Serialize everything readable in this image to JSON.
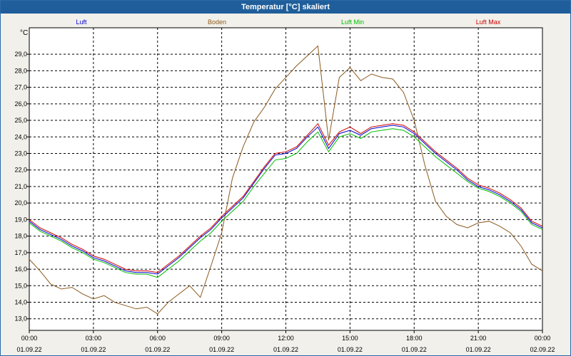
{
  "window": {
    "title": "Temperatur [°C] skaliert"
  },
  "chart_data": {
    "type": "line",
    "title": "Temperatur [°C] skaliert",
    "ylabel": "°C",
    "ylim": [
      12.3,
      30.6
    ],
    "grid": true,
    "legend_placement": "top",
    "y_ticks": [
      "13,0",
      "14,0",
      "15,0",
      "16,0",
      "17,0",
      "18,0",
      "19,0",
      "20,0",
      "21,0",
      "22,0",
      "23,0",
      "24,0",
      "25,0",
      "26,0",
      "27,0",
      "28,0",
      "29,0"
    ],
    "x_ticks": [
      {
        "time": "00:00",
        "date": "01.09.22"
      },
      {
        "time": "03:00",
        "date": "01.09.22"
      },
      {
        "time": "06:00",
        "date": "01.09.22"
      },
      {
        "time": "09:00",
        "date": "01.09.22"
      },
      {
        "time": "12:00",
        "date": "01.09.22"
      },
      {
        "time": "15:00",
        "date": "01.09.22"
      },
      {
        "time": "18:00",
        "date": "01.09.22"
      },
      {
        "time": "21:00",
        "date": "01.09.22"
      },
      {
        "time": "00:00",
        "date": "02.09.22"
      }
    ],
    "series": [
      {
        "name": "Luft",
        "color": "#0000cc",
        "x": [
          0,
          0.5,
          1,
          1.5,
          2,
          2.5,
          3,
          3.5,
          4,
          4.5,
          5,
          5.5,
          6,
          6.5,
          7,
          7.5,
          8,
          8.5,
          9,
          9.5,
          10,
          10.5,
          11,
          11.5,
          12,
          12.5,
          13,
          13.5,
          14,
          14.5,
          15,
          15.5,
          16,
          16.5,
          17,
          17.5,
          18,
          18.5,
          19,
          19.5,
          20,
          20.5,
          21,
          21.5,
          22,
          22.5,
          23,
          23.5,
          24
        ],
        "y": [
          18.9,
          18.4,
          18.1,
          17.8,
          17.4,
          17.1,
          16.7,
          16.5,
          16.2,
          15.9,
          15.8,
          15.8,
          15.7,
          16.2,
          16.7,
          17.3,
          17.9,
          18.4,
          19.1,
          19.7,
          20.3,
          21.2,
          22.1,
          22.9,
          23.0,
          23.3,
          24.0,
          24.6,
          23.3,
          24.2,
          24.4,
          24.1,
          24.5,
          24.6,
          24.7,
          24.6,
          24.2,
          23.6,
          23.0,
          22.5,
          22.0,
          21.4,
          21.0,
          20.8,
          20.5,
          20.1,
          19.6,
          18.8,
          18.5
        ]
      },
      {
        "name": "Boden",
        "color": "#8b5a1e",
        "x": [
          0,
          0.5,
          1,
          1.5,
          2,
          2.5,
          3,
          3.5,
          4,
          4.5,
          5,
          5.5,
          6,
          6.5,
          7,
          7.5,
          8,
          8.5,
          9,
          9.5,
          10,
          10.5,
          11,
          11.5,
          12,
          12.5,
          13,
          13.5,
          14,
          14.5,
          15,
          15.5,
          16,
          16.5,
          17,
          17.5,
          18,
          18.5,
          19,
          19.5,
          20,
          20.5,
          21,
          21.5,
          22,
          22.5,
          23,
          23.5,
          24
        ],
        "y": [
          16.6,
          15.9,
          15.1,
          14.8,
          14.9,
          14.5,
          14.2,
          14.4,
          14.0,
          13.8,
          13.6,
          13.7,
          13.3,
          14.0,
          14.5,
          15.0,
          14.3,
          16.2,
          18.2,
          21.5,
          23.4,
          24.9,
          25.8,
          26.9,
          27.6,
          28.3,
          28.9,
          29.5,
          23.8,
          27.6,
          28.2,
          27.4,
          27.8,
          27.6,
          27.5,
          26.7,
          25.0,
          22.3,
          20.1,
          19.2,
          18.7,
          18.5,
          18.8,
          18.9,
          18.6,
          18.2,
          17.4,
          16.3,
          15.9
        ]
      },
      {
        "name": "Luft Min",
        "color": "#00bb00",
        "x": [
          0,
          0.5,
          1,
          1.5,
          2,
          2.5,
          3,
          3.5,
          4,
          4.5,
          5,
          5.5,
          6,
          6.5,
          7,
          7.5,
          8,
          8.5,
          9,
          9.5,
          10,
          10.5,
          11,
          11.5,
          12,
          12.5,
          13,
          13.5,
          14,
          14.5,
          15,
          15.5,
          16,
          16.5,
          17,
          17.5,
          18,
          18.5,
          19,
          19.5,
          20,
          20.5,
          21,
          21.5,
          22,
          22.5,
          23,
          23.5,
          24
        ],
        "y": [
          18.8,
          18.3,
          18.0,
          17.7,
          17.3,
          17.0,
          16.6,
          16.4,
          16.1,
          15.8,
          15.7,
          15.7,
          15.5,
          16.0,
          16.5,
          17.1,
          17.7,
          18.2,
          18.9,
          19.5,
          20.1,
          21.0,
          21.8,
          22.6,
          22.7,
          23.0,
          23.7,
          24.3,
          23.1,
          24.0,
          24.2,
          23.9,
          24.3,
          24.4,
          24.5,
          24.4,
          24.0,
          23.4,
          22.8,
          22.3,
          21.8,
          21.3,
          20.9,
          20.7,
          20.4,
          20.0,
          19.5,
          18.7,
          18.4
        ]
      },
      {
        "name": "Luft Max",
        "color": "#cc0000",
        "x": [
          0,
          0.5,
          1,
          1.5,
          2,
          2.5,
          3,
          3.5,
          4,
          4.5,
          5,
          5.5,
          6,
          6.5,
          7,
          7.5,
          8,
          8.5,
          9,
          9.5,
          10,
          10.5,
          11,
          11.5,
          12,
          12.5,
          13,
          13.5,
          14,
          14.5,
          15,
          15.5,
          16,
          16.5,
          17,
          17.5,
          18,
          18.5,
          19,
          19.5,
          20,
          20.5,
          21,
          21.5,
          22,
          22.5,
          23,
          23.5,
          24
        ],
        "y": [
          19.0,
          18.5,
          18.2,
          17.9,
          17.5,
          17.2,
          16.8,
          16.6,
          16.3,
          16.0,
          15.9,
          15.9,
          15.8,
          16.3,
          16.8,
          17.4,
          18.0,
          18.5,
          19.2,
          19.8,
          20.4,
          21.3,
          22.2,
          23.0,
          23.1,
          23.4,
          24.1,
          24.8,
          23.5,
          24.3,
          24.6,
          24.2,
          24.6,
          24.7,
          24.8,
          24.7,
          24.3,
          23.7,
          23.1,
          22.6,
          22.1,
          21.5,
          21.1,
          20.9,
          20.6,
          20.2,
          19.7,
          18.9,
          18.6
        ]
      }
    ]
  }
}
